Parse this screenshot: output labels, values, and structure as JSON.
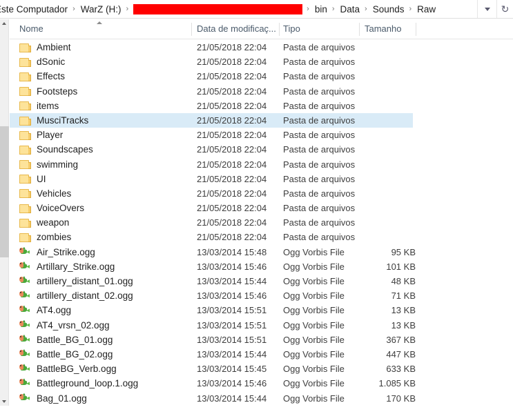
{
  "addressbar": {
    "breadcrumbs": [
      {
        "label": "Este Computador",
        "redacted": false
      },
      {
        "label": "WarZ (H:)",
        "redacted": false
      },
      {
        "label": "",
        "redacted": true
      },
      {
        "label": "bin",
        "redacted": false
      },
      {
        "label": "Data",
        "redacted": false
      },
      {
        "label": "Sounds",
        "redacted": false
      },
      {
        "label": "Raw",
        "redacted": false
      }
    ],
    "separator": "›",
    "dropdown_icon": "chevron-down-icon",
    "refresh_icon": "refresh-icon",
    "refresh_glyph": "↻",
    "redaction_color": "#ff0000"
  },
  "columns": [
    {
      "key": "name",
      "label": "Nome",
      "sorted": true,
      "sort_direction": "ascending"
    },
    {
      "key": "date",
      "label": "Data de modificaç...",
      "sorted": false
    },
    {
      "key": "type",
      "label": "Tipo",
      "sorted": false
    },
    {
      "key": "size",
      "label": "Tamanho",
      "sorted": false
    }
  ],
  "selection": {
    "selected_name": "MusciTracks",
    "highlight_color": "#d9ebf7"
  },
  "rows": [
    {
      "name": "Ambient",
      "date": "21/05/2018 22:04",
      "type": "Pasta de arquivos",
      "size": "",
      "icon": "folder-icon",
      "selected": false,
      "clipped": false
    },
    {
      "name": "dSonic",
      "date": "21/05/2018 22:04",
      "type": "Pasta de arquivos",
      "size": "",
      "icon": "folder-icon",
      "selected": false,
      "clipped": false
    },
    {
      "name": "Effects",
      "date": "21/05/2018 22:04",
      "type": "Pasta de arquivos",
      "size": "",
      "icon": "folder-icon",
      "selected": false,
      "clipped": false
    },
    {
      "name": "Footsteps",
      "date": "21/05/2018 22:04",
      "type": "Pasta de arquivos",
      "size": "",
      "icon": "folder-icon",
      "selected": false,
      "clipped": false
    },
    {
      "name": "items",
      "date": "21/05/2018 22:04",
      "type": "Pasta de arquivos",
      "size": "",
      "icon": "folder-icon",
      "selected": false,
      "clipped": false
    },
    {
      "name": "MusciTracks",
      "date": "21/05/2018 22:04",
      "type": "Pasta de arquivos",
      "size": "",
      "icon": "folder-icon",
      "selected": true,
      "clipped": false
    },
    {
      "name": "Player",
      "date": "21/05/2018 22:04",
      "type": "Pasta de arquivos",
      "size": "",
      "icon": "folder-icon",
      "selected": false,
      "clipped": false
    },
    {
      "name": "Soundscapes",
      "date": "21/05/2018 22:04",
      "type": "Pasta de arquivos",
      "size": "",
      "icon": "folder-icon",
      "selected": false,
      "clipped": false
    },
    {
      "name": "swimming",
      "date": "21/05/2018 22:04",
      "type": "Pasta de arquivos",
      "size": "",
      "icon": "folder-icon",
      "selected": false,
      "clipped": false
    },
    {
      "name": "UI",
      "date": "21/05/2018 22:04",
      "type": "Pasta de arquivos",
      "size": "",
      "icon": "folder-icon",
      "selected": false,
      "clipped": false
    },
    {
      "name": "Vehicles",
      "date": "21/05/2018 22:04",
      "type": "Pasta de arquivos",
      "size": "",
      "icon": "folder-icon",
      "selected": false,
      "clipped": false
    },
    {
      "name": "VoiceOvers",
      "date": "21/05/2018 22:04",
      "type": "Pasta de arquivos",
      "size": "",
      "icon": "folder-icon",
      "selected": false,
      "clipped": false
    },
    {
      "name": "weapon",
      "date": "21/05/2018 22:04",
      "type": "Pasta de arquivos",
      "size": "",
      "icon": "folder-icon",
      "selected": false,
      "clipped": false
    },
    {
      "name": "zombies",
      "date": "21/05/2018 22:04",
      "type": "Pasta de arquivos",
      "size": "",
      "icon": "folder-icon",
      "selected": false,
      "clipped": false
    },
    {
      "name": "Air_Strike.ogg",
      "date": "13/03/2014 15:48",
      "type": "Ogg Vorbis File",
      "size": "95 KB",
      "icon": "ogg-file-icon",
      "selected": false,
      "clipped": false
    },
    {
      "name": "Artillary_Strike.ogg",
      "date": "13/03/2014 15:46",
      "type": "Ogg Vorbis File",
      "size": "101 KB",
      "icon": "ogg-file-icon",
      "selected": false,
      "clipped": false
    },
    {
      "name": "artillery_distant_01.ogg",
      "date": "13/03/2014 15:44",
      "type": "Ogg Vorbis File",
      "size": "48 KB",
      "icon": "ogg-file-icon",
      "selected": false,
      "clipped": false
    },
    {
      "name": "artillery_distant_02.ogg",
      "date": "13/03/2014 15:46",
      "type": "Ogg Vorbis File",
      "size": "71 KB",
      "icon": "ogg-file-icon",
      "selected": false,
      "clipped": false
    },
    {
      "name": "AT4.ogg",
      "date": "13/03/2014 15:51",
      "type": "Ogg Vorbis File",
      "size": "13 KB",
      "icon": "ogg-file-icon",
      "selected": false,
      "clipped": false
    },
    {
      "name": "AT4_vrsn_02.ogg",
      "date": "13/03/2014 15:51",
      "type": "Ogg Vorbis File",
      "size": "13 KB",
      "icon": "ogg-file-icon",
      "selected": false,
      "clipped": false
    },
    {
      "name": "Battle_BG_01.ogg",
      "date": "13/03/2014 15:51",
      "type": "Ogg Vorbis File",
      "size": "367 KB",
      "icon": "ogg-file-icon",
      "selected": false,
      "clipped": false
    },
    {
      "name": "Battle_BG_02.ogg",
      "date": "13/03/2014 15:44",
      "type": "Ogg Vorbis File",
      "size": "447 KB",
      "icon": "ogg-file-icon",
      "selected": false,
      "clipped": false
    },
    {
      "name": "BattleBG_Verb.ogg",
      "date": "13/03/2014 15:45",
      "type": "Ogg Vorbis File",
      "size": "633 KB",
      "icon": "ogg-file-icon",
      "selected": false,
      "clipped": false
    },
    {
      "name": "Battleground_loop.1.ogg",
      "date": "13/03/2014 15:46",
      "type": "Ogg Vorbis File",
      "size": "1.085 KB",
      "icon": "ogg-file-icon",
      "selected": false,
      "clipped": false
    },
    {
      "name": "Bag_01.ogg",
      "date": "13/03/2014 15:44",
      "type": "Ogg Vorbis File",
      "size": "170 KB",
      "icon": "ogg-file-icon",
      "selected": false,
      "clipped": true
    }
  ],
  "scrollbar": {
    "orientation": "vertical",
    "up_arrow": "scroll-up-arrow-icon",
    "down_arrow": "scroll-down-arrow-icon"
  }
}
